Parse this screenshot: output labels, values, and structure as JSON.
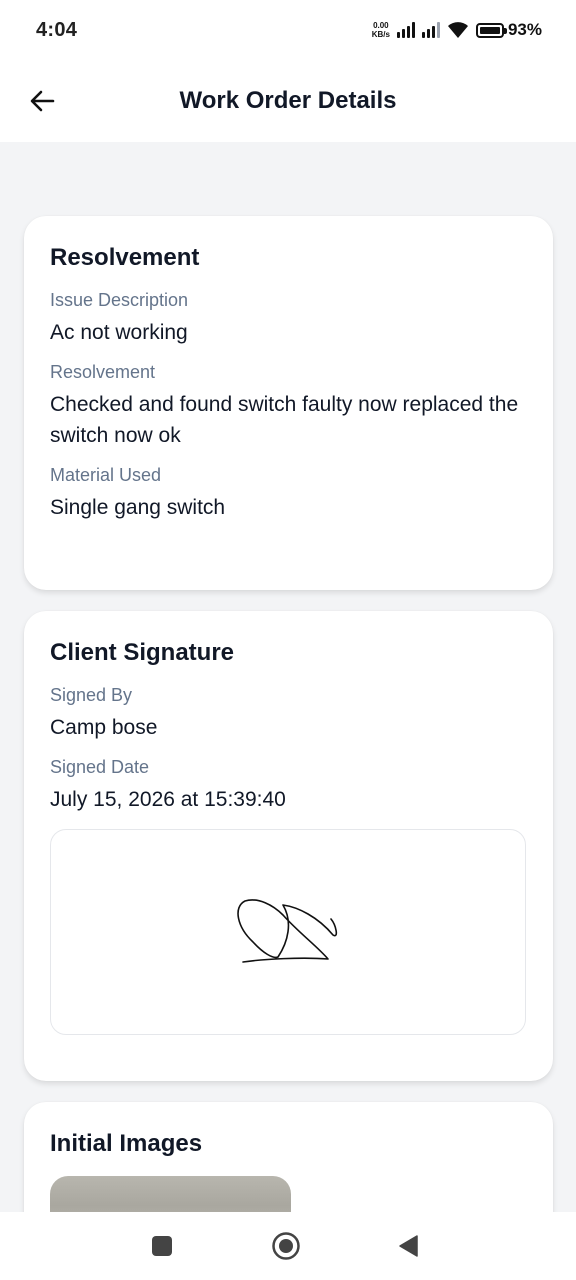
{
  "status_bar": {
    "time": "4:04",
    "net_speed_value": "0.00",
    "net_speed_unit": "KB/s",
    "battery": "93%",
    "icons": [
      "signal-icon",
      "signal-icon",
      "wifi-icon",
      "battery-icon"
    ]
  },
  "header": {
    "title": "Work Order Details",
    "back_icon": "arrow-left-icon"
  },
  "resolvement_card": {
    "title": "Resolvement",
    "fields": [
      {
        "label": "Issue Description",
        "value": "Ac not working"
      },
      {
        "label": "Resolvement",
        "value": "Checked and found switch faulty now replaced the switch now ok"
      },
      {
        "label": "Material Used",
        "value": "Single gang switch"
      }
    ]
  },
  "signature_card": {
    "title": "Client Signature",
    "fields": [
      {
        "label": "Signed By",
        "value": "Camp bose"
      },
      {
        "label": "Signed Date",
        "value": "July 15, 2026 at 15:39:40"
      }
    ]
  },
  "images_card": {
    "title": "Initial Images"
  },
  "nav_bar": {
    "icons": [
      "square-recents-icon",
      "circle-home-icon",
      "triangle-back-icon"
    ]
  },
  "colors": {
    "background": "#f3f4f6",
    "card": "#ffffff",
    "label": "#64748b",
    "text": "#111827"
  }
}
